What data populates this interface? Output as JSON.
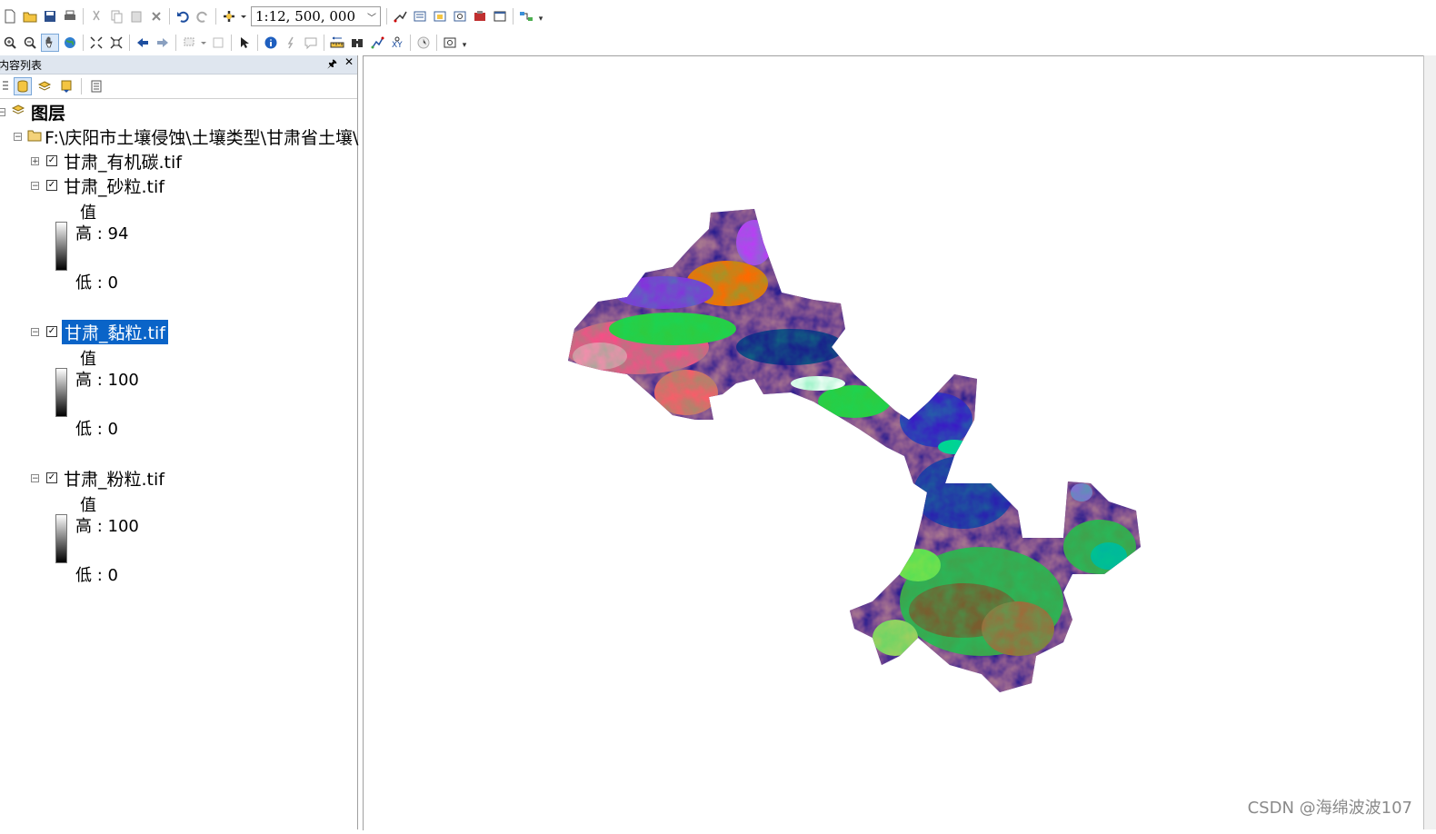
{
  "toolbar": {
    "scale_value": "1:12, 500, 000"
  },
  "toc": {
    "title": "内容列表",
    "root_label": "图层",
    "group_label": "F:\\庆阳市土壤侵蚀\\土壤类型\\甘肃省土壤\\",
    "layers": [
      {
        "name": "甘肃_有机碳.tif",
        "expanded": false,
        "checked": true
      },
      {
        "name": "甘肃_砂粒.tif",
        "expanded": true,
        "checked": true,
        "legend_title": "值",
        "high": "高 : 94",
        "low": "低 : 0"
      },
      {
        "name": "甘肃_黏粒.tif",
        "expanded": true,
        "checked": true,
        "selected": true,
        "legend_title": "值",
        "high": "高 : 100",
        "low": "低 : 0"
      },
      {
        "name": "甘肃_粉粒.tif",
        "expanded": true,
        "checked": true,
        "legend_title": "值",
        "high": "高 : 100",
        "low": "低 : 0"
      }
    ]
  },
  "map": {
    "description_colors": [
      "#1a1a8c",
      "#ff3fa0",
      "#2ecc40",
      "#ff6a00",
      "#8a2be2",
      "#00d0a0",
      "#7a5c2e",
      "#c832ff"
    ]
  },
  "watermark": "CSDN @海绵波波107",
  "colors": {
    "selection": "#0a64c8",
    "toc_header": "#dfe6ef"
  }
}
